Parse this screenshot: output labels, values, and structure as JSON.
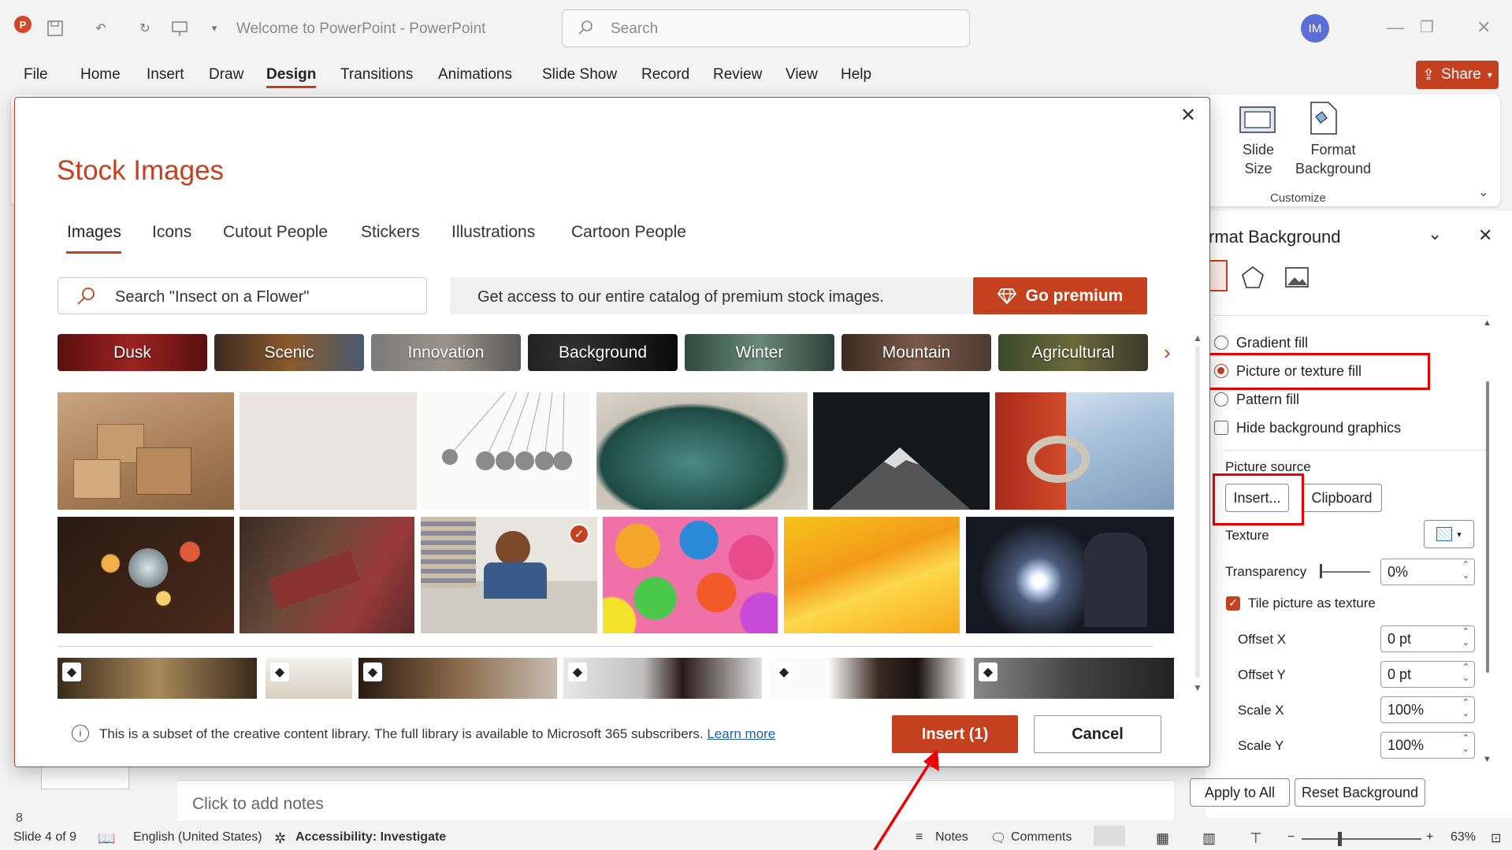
{
  "window": {
    "title": "Welcome to PowerPoint  -  PowerPoint",
    "search_placeholder": "Search",
    "avatar_initials": "IM",
    "share_label": "Share"
  },
  "menu": [
    "File",
    "Home",
    "Insert",
    "Draw",
    "Design",
    "Transitions",
    "Animations",
    "Slide Show",
    "Record",
    "Review",
    "View",
    "Help"
  ],
  "menu_active": "Design",
  "ribbon": {
    "slide_size": "Slide Size",
    "format_background": "Format Background",
    "group_label": "Customize"
  },
  "format_pane": {
    "title": "rmat Background",
    "gradient_fill": "Gradient fill",
    "picture_fill": "Picture or texture fill",
    "pattern_fill": "Pattern fill",
    "hide_graphics": "Hide background graphics",
    "picture_source": "Picture source",
    "insert_button": "Insert...",
    "clipboard_button": "Clipboard",
    "texture": "Texture",
    "transparency": "Transparency",
    "transparency_value": "0%",
    "tile_label": "Tile picture as texture",
    "offset_x": "Offset X",
    "offset_x_value": "0 pt",
    "offset_y": "Offset Y",
    "offset_y_value": "0 pt",
    "scale_x": "Scale X",
    "scale_x_value": "100%",
    "scale_y": "Scale Y",
    "scale_y_value": "100%",
    "apply_all": "Apply to All",
    "reset_background": "Reset Background"
  },
  "dialog": {
    "title": "Stock Images",
    "tabs": [
      "Images",
      "Icons",
      "Cutout People",
      "Stickers",
      "Illustrations",
      "Cartoon People"
    ],
    "search_placeholder": "Search \"Insect on a Flower\"",
    "promo_text": "Get access to our entire catalog of premium stock images.",
    "go_premium": "Go premium",
    "chips": [
      "Dusk",
      "Scenic",
      "Innovation",
      "Background",
      "Winter",
      "Mountain",
      "Agricultural"
    ],
    "info_text": "This is a subset of the creative content library. The full library is available to Microsoft 365 subscribers.",
    "learn_more": "Learn more",
    "insert_button": "Insert (1)",
    "cancel_button": "Cancel"
  },
  "notes_placeholder": "Click to add notes",
  "status": {
    "slide": "Slide 4 of 9",
    "language": "English (United States)",
    "accessibility": "Accessibility: Investigate",
    "notes": "Notes",
    "comments": "Comments",
    "zoom": "63%"
  },
  "thumb_number": "8",
  "colors": {
    "accent": "#c5401e",
    "highlight_box": "#ee0000"
  }
}
